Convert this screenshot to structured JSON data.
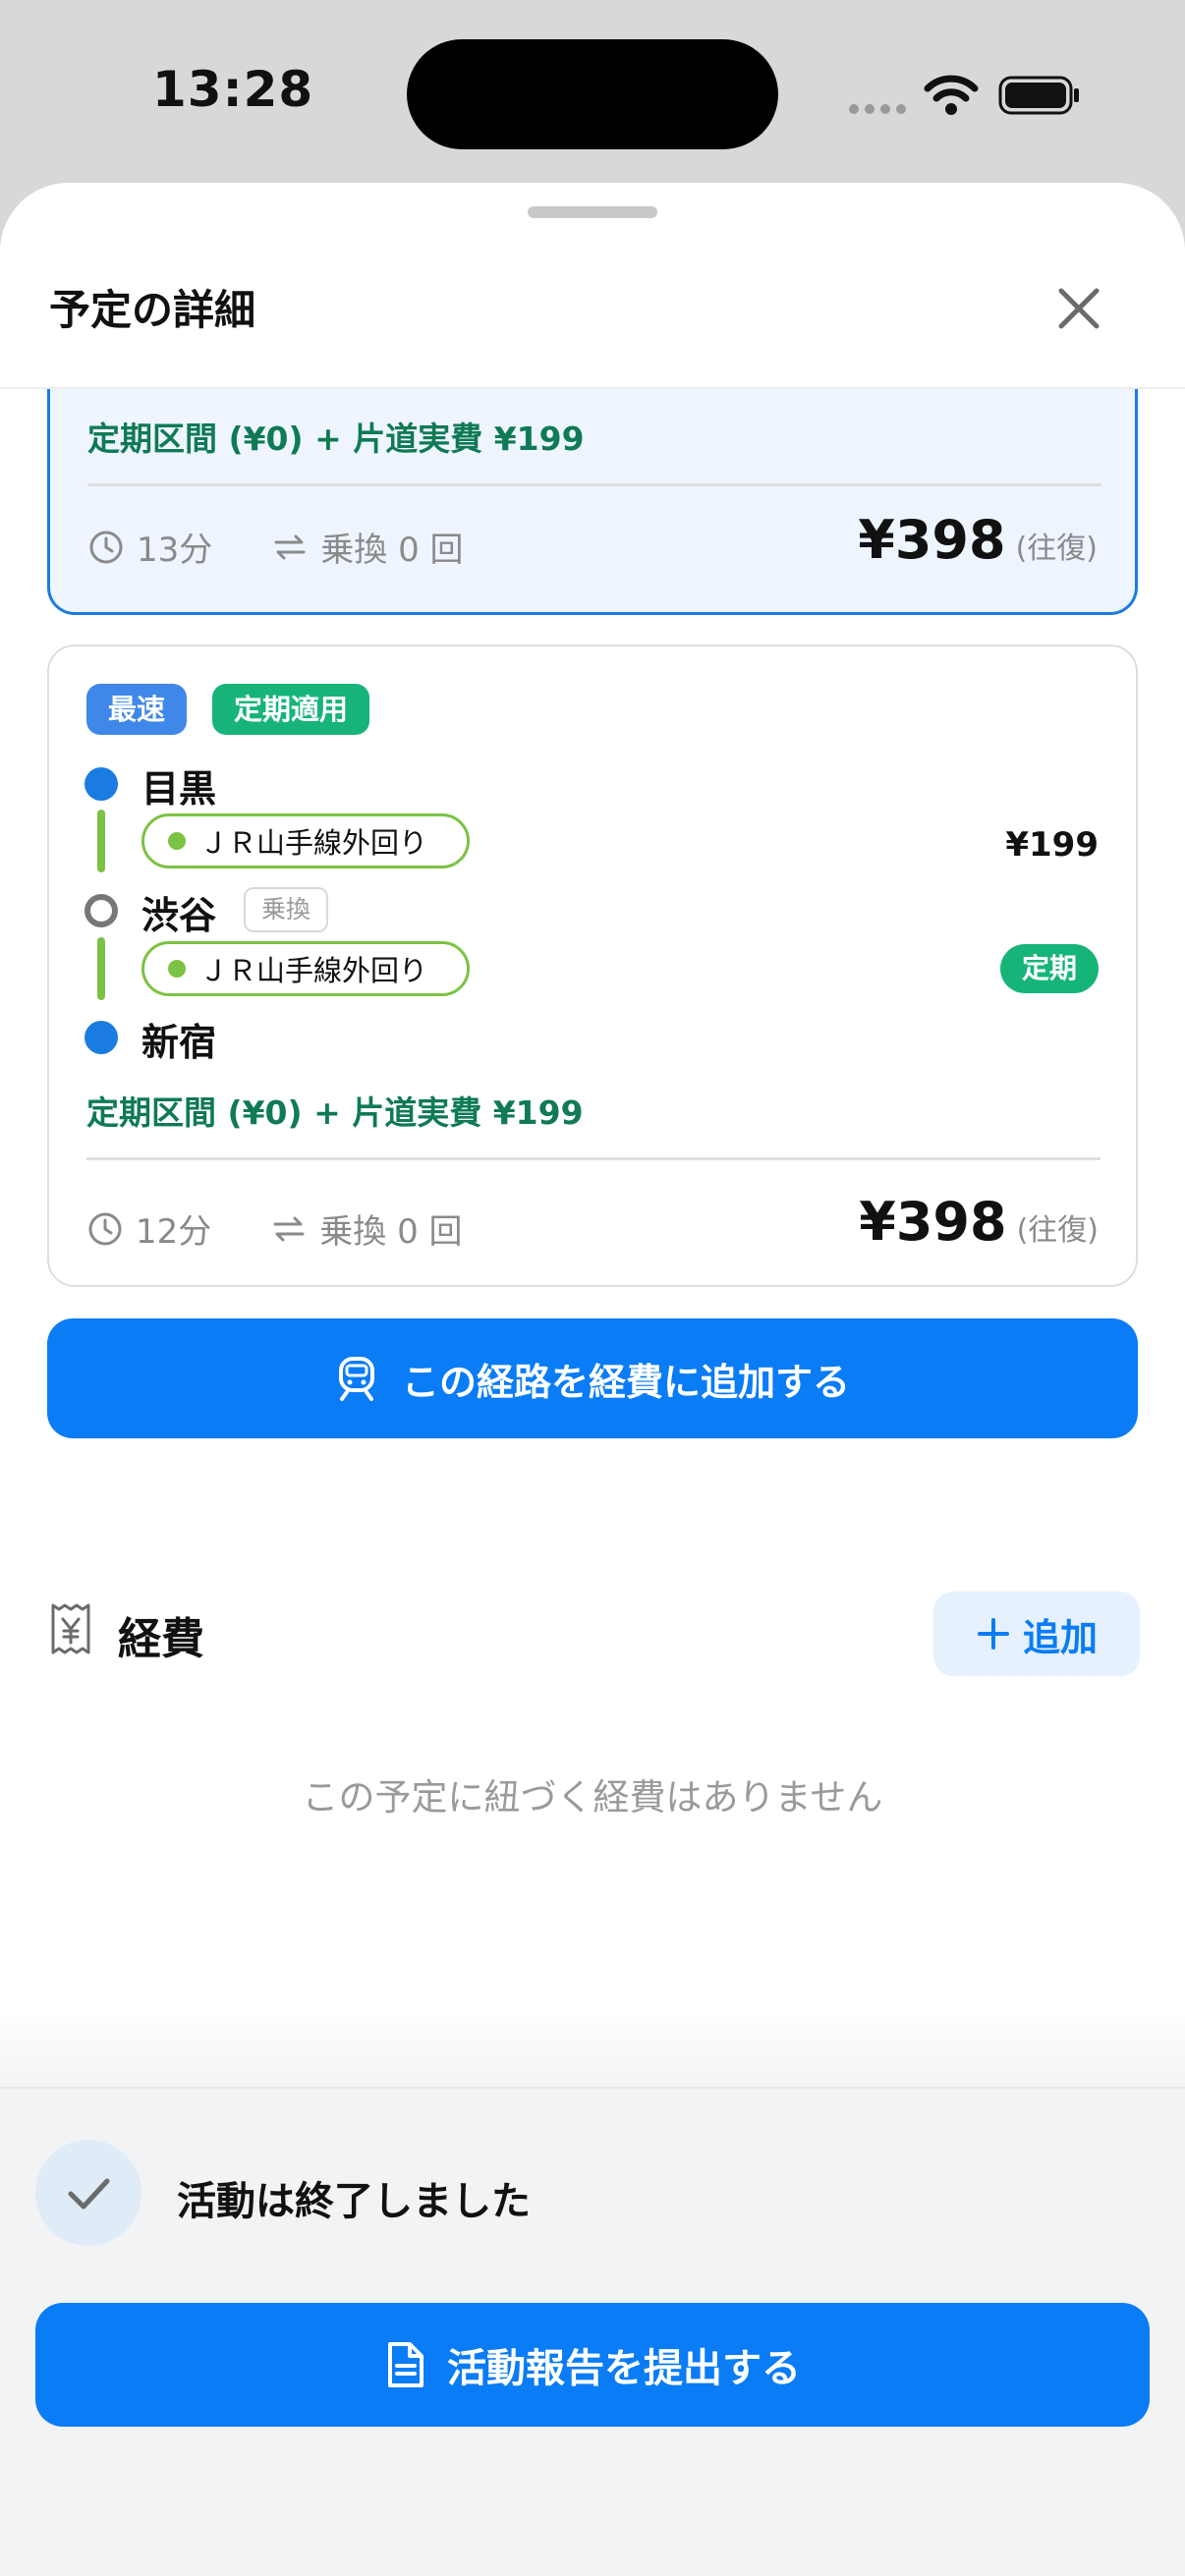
{
  "status_bar": {
    "time": "13:28"
  },
  "sheet": {
    "title": "予定の詳細"
  },
  "routes": [
    {
      "pass_summary": "定期区間 (¥0) + 片道実費 ¥199",
      "duration": "13分",
      "transfers": "乗換 0 回",
      "price": "¥398",
      "price_unit": "(往復)"
    },
    {
      "tags": [
        "最速",
        "定期適用"
      ],
      "stations": [
        "目黒",
        "渋谷",
        "新宿"
      ],
      "transfer_badge": "乗換",
      "segments": [
        {
          "line": "ＪＲ山手線外回り",
          "fare": "¥199"
        },
        {
          "line": "ＪＲ山手線外回り",
          "badge": "定期"
        }
      ],
      "pass_summary": "定期区間 (¥0) + 片道実費 ¥199",
      "duration": "12分",
      "transfers": "乗換 0 回",
      "price": "¥398",
      "price_unit": "(往復)"
    }
  ],
  "add_route_label": "この経路を経費に追加する",
  "expenses": {
    "title": "経費",
    "add_label": "追加",
    "empty_message": "この予定に紐づく経費はありません"
  },
  "activity": {
    "status_text": "活動は終了しました",
    "submit_label": "活動報告を提出する"
  },
  "colors": {
    "primary": "#0a7cf5",
    "pass_green": "#17b47a",
    "line_green": "#7cc243",
    "summary_green": "#0f7a55"
  }
}
